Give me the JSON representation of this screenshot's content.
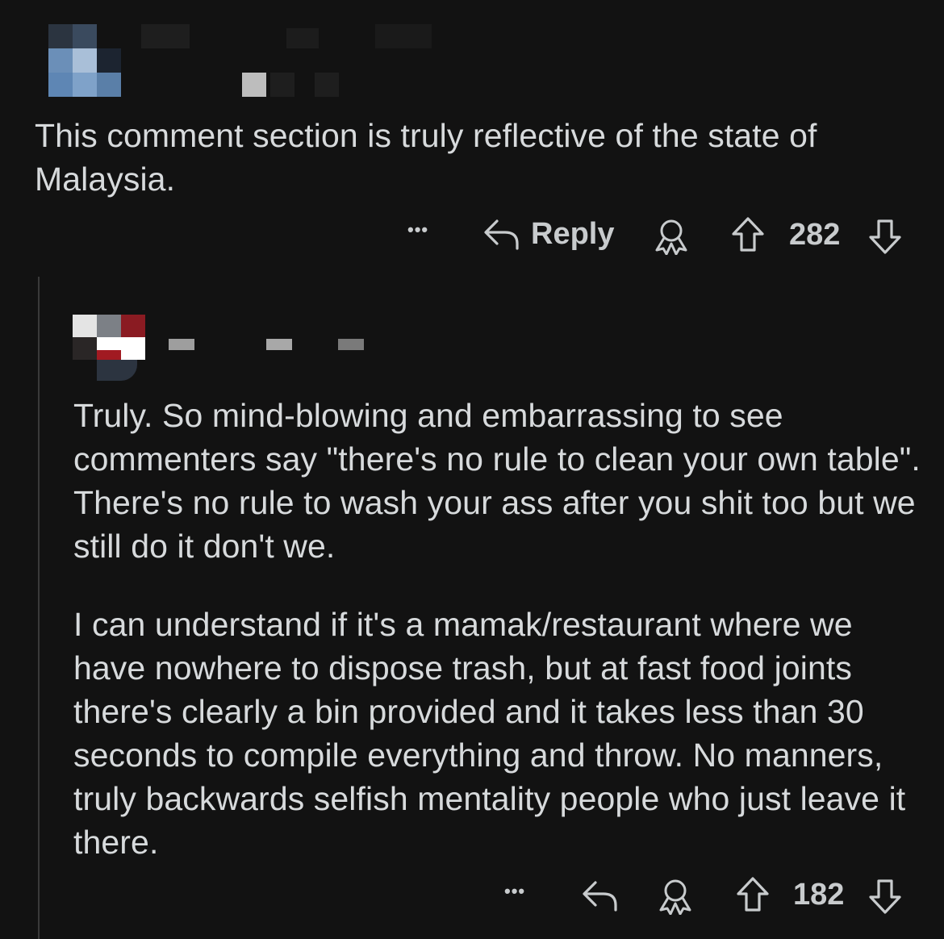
{
  "comments": [
    {
      "text": "This comment section is truly reflective of the state of Malaysia.",
      "actions": {
        "more_label": "•••",
        "reply_label": "Reply",
        "score": "282"
      }
    },
    {
      "paragraphs": [
        "Truly. So mind-blowing and embarrassing to see commenters say \"there's no rule to clean your own table\". There's no rule to wash your ass after you shit too but we still do it don't we.",
        "I can understand if it's a mamak/restaurant where we have nowhere to dispose trash, but at fast food joints there's clearly a bin provided and it takes less than 30 seconds to compile everything and throw. No manners, truly backwards selfish mentality people who just leave it there."
      ],
      "actions": {
        "more_label": "•••",
        "score": "182"
      }
    }
  ],
  "colors": {
    "background": "#121212",
    "text": "#d7dadc",
    "thread_line": "#3a3a3a"
  }
}
